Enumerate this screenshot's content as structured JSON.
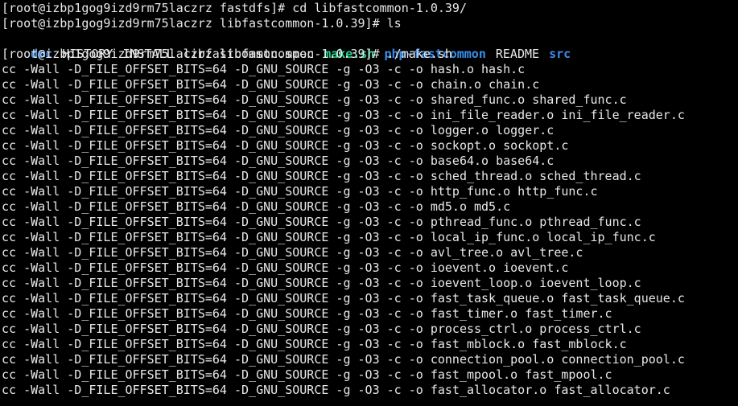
{
  "terminal": {
    "prompt_lines": [
      "[root@izbp1gog9izd9rm75laczrz fastdfs]# cd libfastcommon-1.0.39/",
      "[root@izbp1gog9izd9rm75laczrz libfastcommon-1.0.39]# ls"
    ],
    "ls_output": [
      {
        "name": "doc",
        "type": "dir"
      },
      {
        "name": "HISTORY",
        "type": "file"
      },
      {
        "name": "INSTALL",
        "type": "file"
      },
      {
        "name": "libfastcommon.spec",
        "type": "file"
      },
      {
        "name": "make.sh",
        "type": "exe"
      },
      {
        "name": "php-fastcommon",
        "type": "dir"
      },
      {
        "name": "README",
        "type": "file"
      },
      {
        "name": "src",
        "type": "dir"
      }
    ],
    "make_prompt": "[root@izbp1gog9izd9rm75laczrz libfastcommon-1.0.39]# ./make.sh",
    "compile_lines": [
      "cc -Wall -D_FILE_OFFSET_BITS=64 -D_GNU_SOURCE -g -O3 -c -o hash.o hash.c",
      "cc -Wall -D_FILE_OFFSET_BITS=64 -D_GNU_SOURCE -g -O3 -c -o chain.o chain.c",
      "cc -Wall -D_FILE_OFFSET_BITS=64 -D_GNU_SOURCE -g -O3 -c -o shared_func.o shared_func.c",
      "cc -Wall -D_FILE_OFFSET_BITS=64 -D_GNU_SOURCE -g -O3 -c -o ini_file_reader.o ini_file_reader.c",
      "cc -Wall -D_FILE_OFFSET_BITS=64 -D_GNU_SOURCE -g -O3 -c -o logger.o logger.c",
      "cc -Wall -D_FILE_OFFSET_BITS=64 -D_GNU_SOURCE -g -O3 -c -o sockopt.o sockopt.c",
      "cc -Wall -D_FILE_OFFSET_BITS=64 -D_GNU_SOURCE -g -O3 -c -o base64.o base64.c",
      "cc -Wall -D_FILE_OFFSET_BITS=64 -D_GNU_SOURCE -g -O3 -c -o sched_thread.o sched_thread.c",
      "cc -Wall -D_FILE_OFFSET_BITS=64 -D_GNU_SOURCE -g -O3 -c -o http_func.o http_func.c",
      "cc -Wall -D_FILE_OFFSET_BITS=64 -D_GNU_SOURCE -g -O3 -c -o md5.o md5.c",
      "cc -Wall -D_FILE_OFFSET_BITS=64 -D_GNU_SOURCE -g -O3 -c -o pthread_func.o pthread_func.c",
      "cc -Wall -D_FILE_OFFSET_BITS=64 -D_GNU_SOURCE -g -O3 -c -o local_ip_func.o local_ip_func.c",
      "cc -Wall -D_FILE_OFFSET_BITS=64 -D_GNU_SOURCE -g -O3 -c -o avl_tree.o avl_tree.c",
      "cc -Wall -D_FILE_OFFSET_BITS=64 -D_GNU_SOURCE -g -O3 -c -o ioevent.o ioevent.c",
      "cc -Wall -D_FILE_OFFSET_BITS=64 -D_GNU_SOURCE -g -O3 -c -o ioevent_loop.o ioevent_loop.c",
      "cc -Wall -D_FILE_OFFSET_BITS=64 -D_GNU_SOURCE -g -O3 -c -o fast_task_queue.o fast_task_queue.c",
      "cc -Wall -D_FILE_OFFSET_BITS=64 -D_GNU_SOURCE -g -O3 -c -o fast_timer.o fast_timer.c",
      "cc -Wall -D_FILE_OFFSET_BITS=64 -D_GNU_SOURCE -g -O3 -c -o process_ctrl.o process_ctrl.c",
      "cc -Wall -D_FILE_OFFSET_BITS=64 -D_GNU_SOURCE -g -O3 -c -o fast_mblock.o fast_mblock.c",
      "cc -Wall -D_FILE_OFFSET_BITS=64 -D_GNU_SOURCE -g -O3 -c -o connection_pool.o connection_pool.c",
      "cc -Wall -D_FILE_OFFSET_BITS=64 -D_GNU_SOURCE -g -O3 -c -o fast_mpool.o fast_mpool.c",
      "cc -Wall -D_FILE_OFFSET_BITS=64 -D_GNU_SOURCE -g -O3 -c -o fast_allocator.o fast_allocator.c"
    ]
  },
  "colors": {
    "background": "#000000",
    "text": "#e8e8e8",
    "directory": "#3b8eea",
    "executable": "#23d18b"
  }
}
